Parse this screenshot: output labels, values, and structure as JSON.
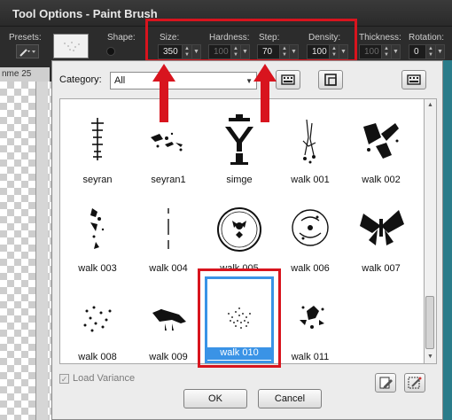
{
  "window": {
    "title": "Tool Options - Paint Brush"
  },
  "toolbar": {
    "presets_label": "Presets:",
    "shape_label": "Shape:",
    "size": {
      "label": "Size:",
      "value": "350"
    },
    "hardness": {
      "label": "Hardness:",
      "value": "100"
    },
    "step": {
      "label": "Step:",
      "value": "70"
    },
    "density": {
      "label": "Density:",
      "value": "100"
    },
    "thickness": {
      "label": "Thickness:",
      "value": "100"
    },
    "rotation": {
      "label": "Rotation:",
      "value": "0"
    }
  },
  "workspace": {
    "doc_tab": "nme 25"
  },
  "dialog": {
    "category_label": "Category:",
    "category_value": "All",
    "brushes": [
      {
        "name": "seyran",
        "icon": "seyran-brush-icon"
      },
      {
        "name": "seyran1",
        "icon": "seyran1-brush-icon"
      },
      {
        "name": "simge",
        "icon": "simge-brush-icon"
      },
      {
        "name": "walk 001",
        "icon": "walk-001-brush-icon"
      },
      {
        "name": "walk 002",
        "icon": "walk-002-brush-icon"
      },
      {
        "name": "walk 003",
        "icon": "walk-003-brush-icon"
      },
      {
        "name": "walk 004",
        "icon": "walk-004-brush-icon"
      },
      {
        "name": "walk 005",
        "icon": "walk-005-brush-icon"
      },
      {
        "name": "walk 006",
        "icon": "walk-006-brush-icon"
      },
      {
        "name": "walk 007",
        "icon": "walk-007-brush-icon"
      },
      {
        "name": "walk 008",
        "icon": "walk-008-brush-icon"
      },
      {
        "name": "walk 009",
        "icon": "walk-009-brush-icon"
      },
      {
        "name": "walk 010",
        "icon": "walk-010-brush-icon",
        "selected": true
      },
      {
        "name": "walk 011",
        "icon": "walk-011-brush-icon"
      }
    ],
    "load_variance_label": "Load Variance",
    "ok_label": "OK",
    "cancel_label": "Cancel"
  },
  "colors": {
    "highlight_red": "#d8141e",
    "selection_blue": "#3a93e6"
  }
}
